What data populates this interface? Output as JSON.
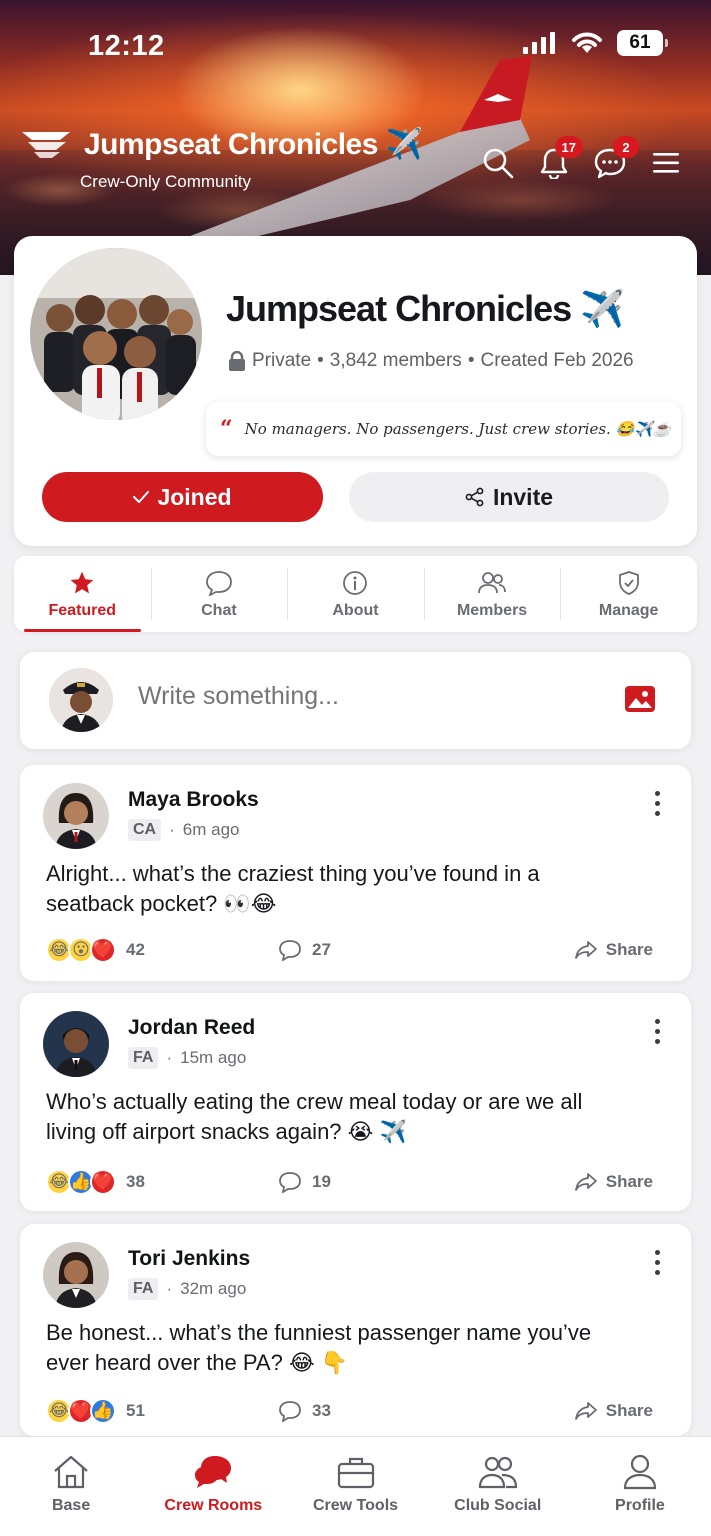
{
  "status_bar": {
    "time": "12:12",
    "battery": "61"
  },
  "header": {
    "title": "Jumpseat Chronicles ✈️",
    "subtitle": "Crew-Only Community",
    "notifications_count": "17",
    "messages_count": "2"
  },
  "group": {
    "name": "Jumpseat Chronicles ✈️",
    "privacy": "Private",
    "members": "3,842 members",
    "created": "Created Feb 2026",
    "tagline": "No managers. No passengers. Just crew stories. 😂✈️☕",
    "joined_label": "Joined",
    "invite_label": "Invite"
  },
  "tabs": [
    {
      "label": "Featured",
      "icon": "star-icon"
    },
    {
      "label": "Chat",
      "icon": "chat-bubble-icon"
    },
    {
      "label": "About",
      "icon": "info-icon"
    },
    {
      "label": "Members",
      "icon": "members-icon"
    },
    {
      "label": "Manage",
      "icon": "shield-check-icon"
    }
  ],
  "composer": {
    "placeholder": "Write something..."
  },
  "posts": [
    {
      "author": "Maya Brooks",
      "role": "CA",
      "time": "6m ago",
      "text": "Alright... what’s the craziest thing you’ve found in a seatback pocket? 👀😂",
      "reactions": [
        "😂",
        "😮",
        "❤️"
      ],
      "reaction_count": "42",
      "comment_count": "27",
      "share_label": "Share"
    },
    {
      "author": "Jordan Reed",
      "role": "FA",
      "time": "15m ago",
      "text": "Who’s actually eating the crew meal today or are we all living off airport snacks again? 😭 ✈️",
      "reactions": [
        "😂",
        "👍",
        "❤️"
      ],
      "reaction_count": "38",
      "comment_count": "19",
      "share_label": "Share"
    },
    {
      "author": "Tori Jenkins",
      "role": "FA",
      "time": "32m ago",
      "text": "Be honest... what’s the funniest passenger name you’ve ever heard over the PA? 😂 👇",
      "reactions": [
        "😂",
        "❤️",
        "👍"
      ],
      "reaction_count": "51",
      "comment_count": "33",
      "share_label": "Share"
    }
  ],
  "bottom_nav": [
    {
      "label": "Base",
      "icon": "home-icon"
    },
    {
      "label": "Crew Rooms",
      "icon": "crew-rooms-icon"
    },
    {
      "label": "Crew Tools",
      "icon": "briefcase-icon"
    },
    {
      "label": "Club Social",
      "icon": "people-icon"
    },
    {
      "label": "Profile",
      "icon": "person-icon"
    }
  ],
  "colors": {
    "accent": "#cf1a1f",
    "text": "#15161a",
    "muted": "#6a6c73",
    "background": "#f1f1f4"
  }
}
